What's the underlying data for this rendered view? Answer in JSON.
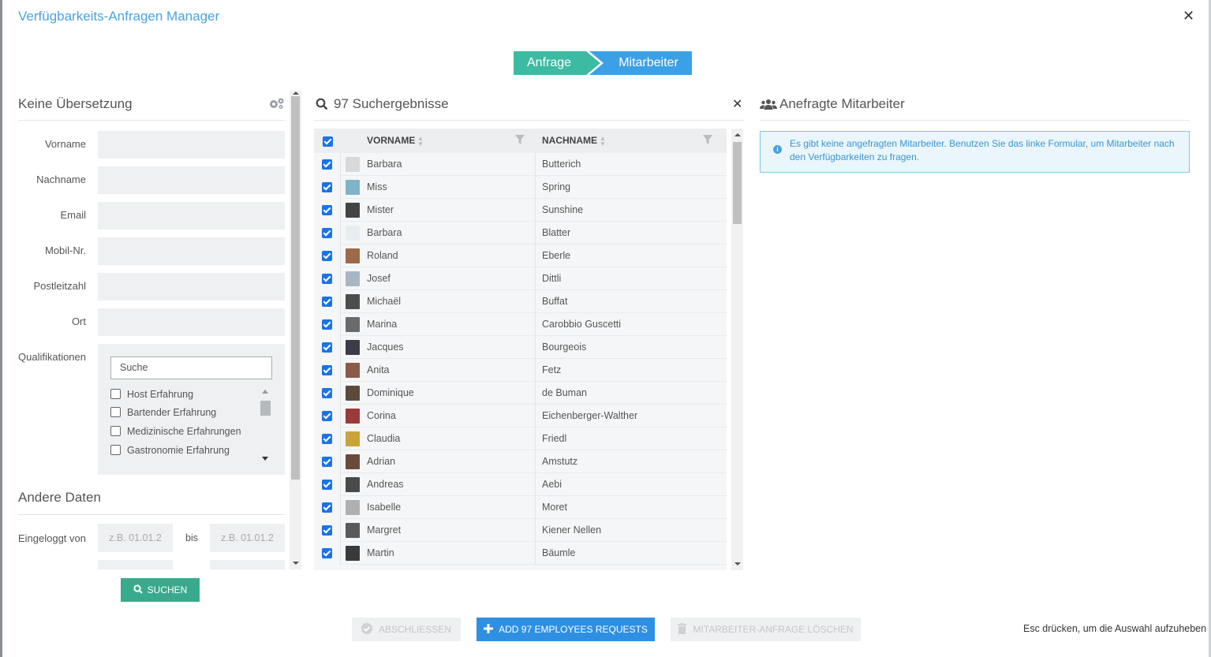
{
  "modal": {
    "title": "Verfügbarkeits-Anfragen Manager",
    "close_symbol": "✕"
  },
  "steps": [
    {
      "label": "Anfrage",
      "color": "#3cbba2"
    },
    {
      "label": "Mitarbeiter",
      "color": "#3ca0e6"
    }
  ],
  "form": {
    "section_title": "Keine Übersetzung",
    "settings_icon": "gears-icon",
    "fields": [
      {
        "label": "Vorname",
        "value": ""
      },
      {
        "label": "Nachname",
        "value": ""
      },
      {
        "label": "Email",
        "value": ""
      },
      {
        "label": "Mobil-Nr.",
        "value": ""
      },
      {
        "label": "Postleitzahl",
        "value": ""
      },
      {
        "label": "Ort",
        "value": ""
      }
    ],
    "qualifications": {
      "label": "Qualifikationen",
      "search_placeholder": "Suche",
      "items": [
        {
          "label": "Host Erfahrung",
          "checked": false
        },
        {
          "label": "Bartender Erfahrung",
          "checked": false
        },
        {
          "label": "Medizinische Erfahrungen",
          "checked": false
        },
        {
          "label": "Gastronomie Erfahrung",
          "checked": false
        }
      ]
    },
    "other_section_title": "Andere Daten",
    "logged_in_label": "Eingeloggt von",
    "between_label": "bis",
    "date_placeholder": "z.B. 01.01.2",
    "search_button": "SUCHEN"
  },
  "results": {
    "title": "97 Suchergebnisse",
    "close_symbol": "✕",
    "columns": [
      "VORNAME",
      "NACHNAME"
    ],
    "rows": [
      {
        "first": "Barbara",
        "last": "Butterich",
        "avatar": "#d9d9d9"
      },
      {
        "first": "Miss",
        "last": "Spring",
        "avatar": "#7fb3c8"
      },
      {
        "first": "Mister",
        "last": "Sunshine",
        "avatar": "#444444"
      },
      {
        "first": "Barbara",
        "last": "Blatter",
        "avatar": "#e7eef2"
      },
      {
        "first": "Roland",
        "last": "Eberle",
        "avatar": "#9a6a4a"
      },
      {
        "first": "Josef",
        "last": "Dittli",
        "avatar": "#a9b6c4"
      },
      {
        "first": "Michaël",
        "last": "Buffat",
        "avatar": "#4a4f4a"
      },
      {
        "first": "Marina",
        "last": "Carobbio Guscetti",
        "avatar": "#6b6b6b"
      },
      {
        "first": "Jacques",
        "last": "Bourgeois",
        "avatar": "#3b3b4a"
      },
      {
        "first": "Anita",
        "last": "Fetz",
        "avatar": "#8a5a4a"
      },
      {
        "first": "Dominique",
        "last": "de Buman",
        "avatar": "#5a4a3a"
      },
      {
        "first": "Corina",
        "last": "Eichenberger-Walther",
        "avatar": "#9a3a3a"
      },
      {
        "first": "Claudia",
        "last": "Friedl",
        "avatar": "#c8a43a"
      },
      {
        "first": "Adrian",
        "last": "Amstutz",
        "avatar": "#6a4a3a"
      },
      {
        "first": "Andreas",
        "last": "Aebi",
        "avatar": "#4a4a4a"
      },
      {
        "first": "Isabelle",
        "last": "Moret",
        "avatar": "#b0b0b0"
      },
      {
        "first": "Margret",
        "last": "Kiener Nellen",
        "avatar": "#5a5a5a"
      },
      {
        "first": "Martin",
        "last": "Bäumle",
        "avatar": "#3a3a3a"
      }
    ]
  },
  "requested": {
    "title": "Anefragte Mitarbeiter",
    "icon": "users-icon",
    "info_text": "Es gibt keine angefragten Mitarbeiter. Benutzen Sie das linke Formular, um Mitarbeiter nach den Verfügbarkeiten zu fragen."
  },
  "footer": {
    "close_button": "ABSCHLIESSEN",
    "add_button": "ADD 97 EMPLOYEES REQUESTS",
    "delete_button": "MITARBEITER-ANFRAGE LÖSCHEN",
    "esc_hint": "Esc drücken, um die Auswahl aufzuheben"
  },
  "colors": {
    "accent": "#2e8fe3",
    "success": "#3aaa8e",
    "title": "#4aa3df"
  }
}
